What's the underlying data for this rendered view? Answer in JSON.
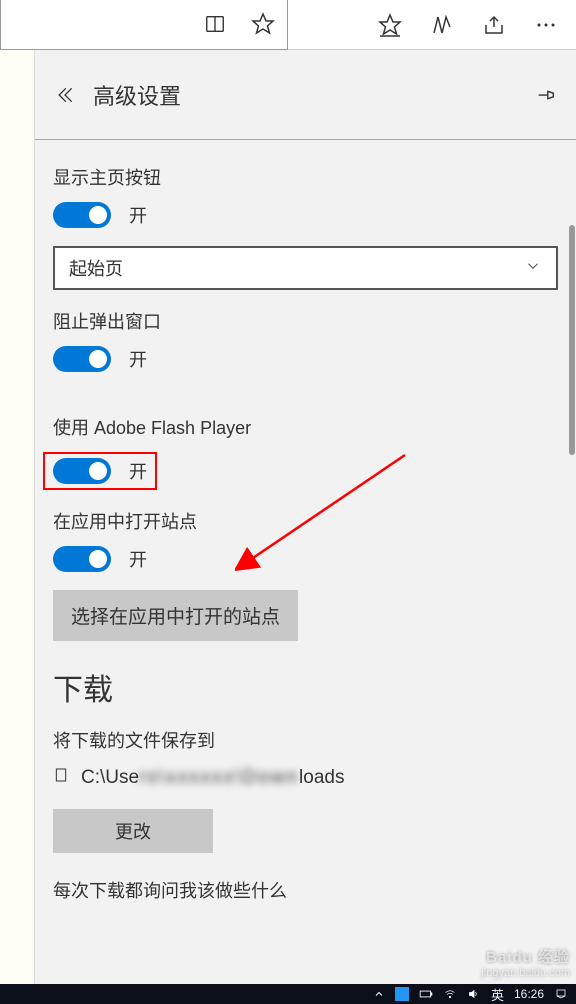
{
  "panel": {
    "title": "高级设置"
  },
  "settings": {
    "show_home_button": {
      "label": "显示主页按钮",
      "state": "开"
    },
    "homepage_dropdown": {
      "value": "起始页"
    },
    "block_popups": {
      "label": "阻止弹出窗口",
      "state": "开"
    },
    "flash": {
      "label": "使用 Adobe Flash Player",
      "state": "开"
    },
    "open_in_app": {
      "label": "在应用中打开站点",
      "state": "开"
    },
    "choose_sites_button": "选择在应用中打开的站点"
  },
  "downloads": {
    "heading": "下载",
    "save_to_label": "将下载的文件保存到",
    "path_prefix": "C:\\Use",
    "path_suffix": "loads",
    "change_button": "更改",
    "ask_each_time": "每次下载都询问我该做些什么"
  },
  "taskbar": {
    "ime": "英",
    "time": "16:26"
  },
  "watermark": {
    "brand": "Baidu 经验",
    "url": "jingyan.baidu.com"
  }
}
